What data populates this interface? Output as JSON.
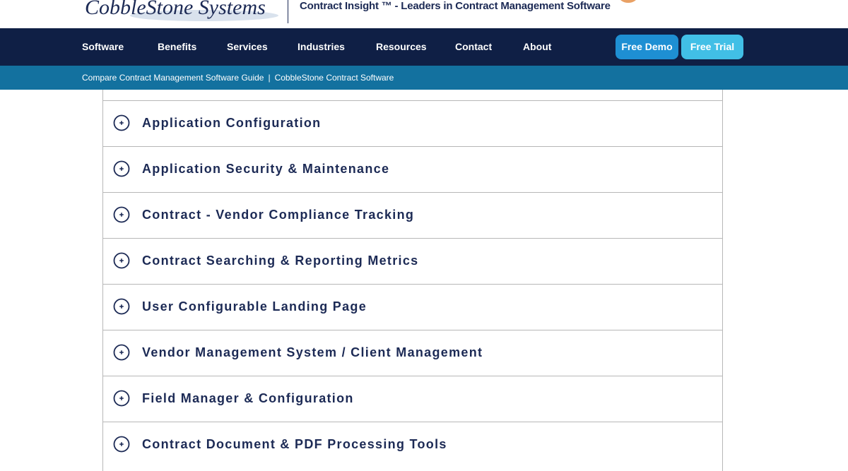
{
  "header": {
    "logo_text": "CobbleStone Systems",
    "tagline": "Contract Insight ™ - Leaders in Contract Management Software"
  },
  "nav": {
    "items": [
      "Software",
      "Benefits",
      "Services",
      "Industries",
      "Resources",
      "Contact",
      "About"
    ],
    "demo_label": "Free Demo",
    "trial_label": "Free Trial"
  },
  "breadcrumb": {
    "link": "Compare Contract Management Software Guide",
    "separator": "|",
    "current": "CobbleStone Contract Software"
  },
  "accordion": {
    "items": [
      "Application Configuration",
      "Application Security & Maintenance",
      "Contract - Vendor Compliance Tracking",
      "Contract Searching & Reporting Metrics",
      "User Configurable Landing Page",
      "Vendor Management System / Client Management",
      "Field Manager & Configuration",
      "Contract Document & PDF Processing Tools"
    ]
  },
  "colors": {
    "navy": "#0f1f45",
    "sub_bar": "#13719f",
    "demo_button": "#1e8fd3",
    "trial_button": "#41bfe6",
    "text_dark": "#1c2a55"
  },
  "icons": {
    "accordion_expand": "plus-circle-icon"
  }
}
